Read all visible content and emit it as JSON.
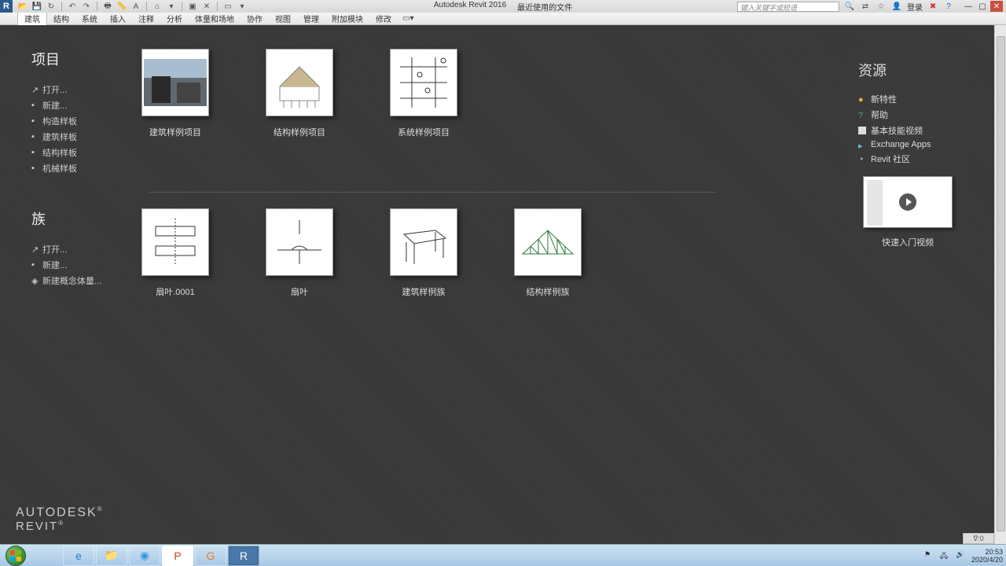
{
  "titlebar": {
    "app_name": "Autodesk Revit 2016",
    "doc_title": "最近使用的文件",
    "search_placeholder": "键入关键字或短语",
    "login": "登录"
  },
  "ribbon": {
    "tabs": [
      "建筑",
      "结构",
      "系统",
      "插入",
      "注释",
      "分析",
      "体量和场地",
      "协作",
      "视图",
      "管理",
      "附加模块",
      "修改"
    ]
  },
  "start": {
    "projects": {
      "title": "项目",
      "links": [
        "打开...",
        "新建...",
        "构造样板",
        "建筑样板",
        "结构样板",
        "机械样板"
      ],
      "tiles": [
        {
          "label": "建筑样例项目"
        },
        {
          "label": "结构样例项目"
        },
        {
          "label": "系统样例项目"
        }
      ]
    },
    "families": {
      "title": "族",
      "links": [
        "打开...",
        "新建...",
        "新建概念体量..."
      ],
      "tiles": [
        {
          "label": "扇叶.0001"
        },
        {
          "label": "扇叶"
        },
        {
          "label": "建筑样例族"
        },
        {
          "label": "结构样例族"
        }
      ]
    },
    "resources": {
      "title": "资源",
      "links": [
        "新特性",
        "帮助",
        "基本技能视频",
        "Exchange Apps",
        "Revit 社区"
      ],
      "video_label": "快速入门视频"
    }
  },
  "brand": {
    "line1": "AUTODESK",
    "line2": "REVIT"
  },
  "filter": "∇:0",
  "taskbar": {
    "clock_time": "20:53",
    "clock_date": "2020/4/20"
  }
}
